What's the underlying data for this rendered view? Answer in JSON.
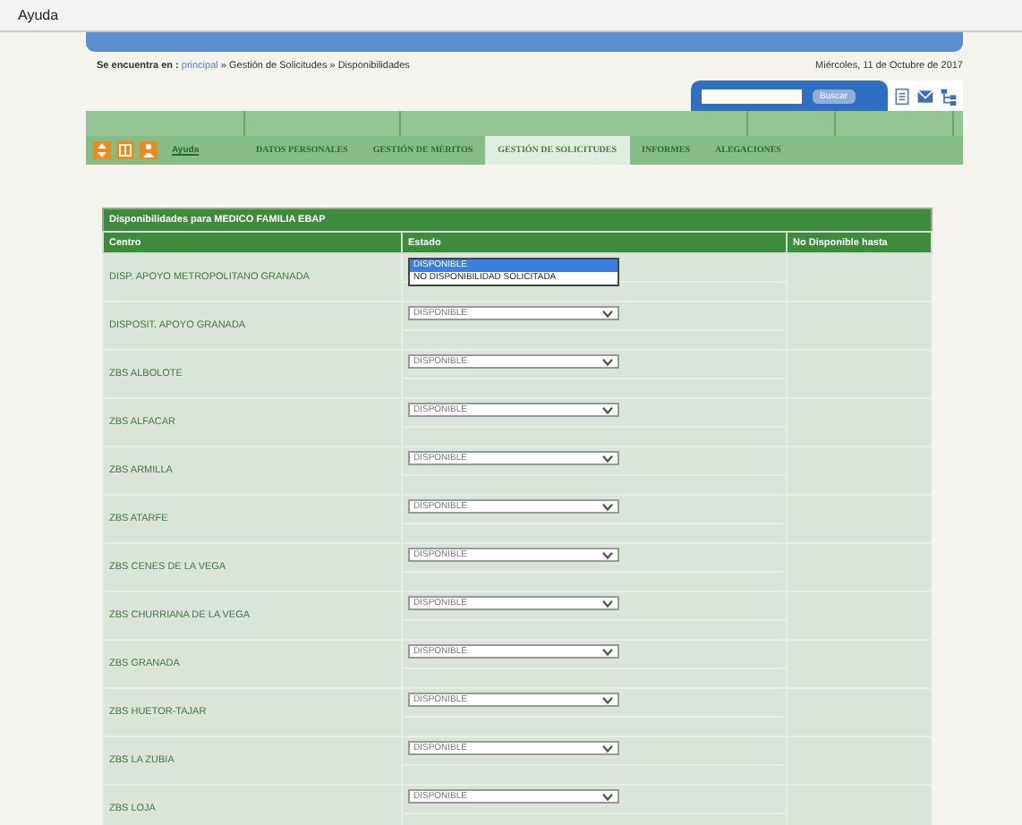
{
  "menu_bar": {
    "items": [
      "Ayuda"
    ]
  },
  "breadcrumb": {
    "label": "Se encuentra en :",
    "link": "principal",
    "path": "» Gestión de Solicitudes » Disponibilidades"
  },
  "date": "Miércoles, 11 de Octubre de 2017",
  "search": {
    "button": "Buscar"
  },
  "nav": {
    "help_link": "Ayuda",
    "tabs": [
      {
        "label": "DATOS PERSONALES",
        "selected": false
      },
      {
        "label": "GESTIÓN DE MÉRITOS",
        "selected": false
      },
      {
        "label": "GESTIÓN DE SOLICITUDES",
        "selected": true
      },
      {
        "label": "INFORMES",
        "selected": false
      },
      {
        "label": "ALEGACIONES",
        "selected": false
      }
    ]
  },
  "table": {
    "title": "Disponibilidades para MEDICO FAMILIA EBAP",
    "columns": [
      "Centro",
      "Estado",
      "No Disponible hasta"
    ],
    "rows": [
      {
        "centro": "DISP. APOYO METROPOLITANO GRANADA",
        "expanded": true,
        "options": [
          {
            "label": "DISPONIBLE",
            "selected": true
          },
          {
            "label": "NO DISPONIBILIDAD SOLICITADA",
            "selected": false
          }
        ]
      },
      {
        "centro": "DISPOSIT. APOYO GRANADA",
        "expanded": false,
        "estado": "DISPONIBLE"
      },
      {
        "centro": "ZBS ALBOLOTE",
        "expanded": false,
        "estado": "DISPONIBLE"
      },
      {
        "centro": "ZBS ALFACAR",
        "expanded": false,
        "estado": "DISPONIBLE"
      },
      {
        "centro": "ZBS ARMILLA",
        "expanded": false,
        "estado": "DISPONIBLE"
      },
      {
        "centro": "ZBS ATARFE",
        "expanded": false,
        "estado": "DISPONIBLE"
      },
      {
        "centro": "ZBS CENES DE LA VEGA",
        "expanded": false,
        "estado": "DISPONIBLE"
      },
      {
        "centro": "ZBS CHURRIANA DE LA VEGA",
        "expanded": false,
        "estado": "DISPONIBLE"
      },
      {
        "centro": "ZBS GRANADA",
        "expanded": false,
        "estado": "DISPONIBLE"
      },
      {
        "centro": "ZBS HUETOR-TAJAR",
        "expanded": false,
        "estado": "DISPONIBLE"
      },
      {
        "centro": "ZBS LA ZUBIA",
        "expanded": false,
        "estado": "DISPONIBLE"
      },
      {
        "centro": "ZBS LOJA",
        "expanded": false,
        "estado": "DISPONIBLE"
      }
    ]
  }
}
